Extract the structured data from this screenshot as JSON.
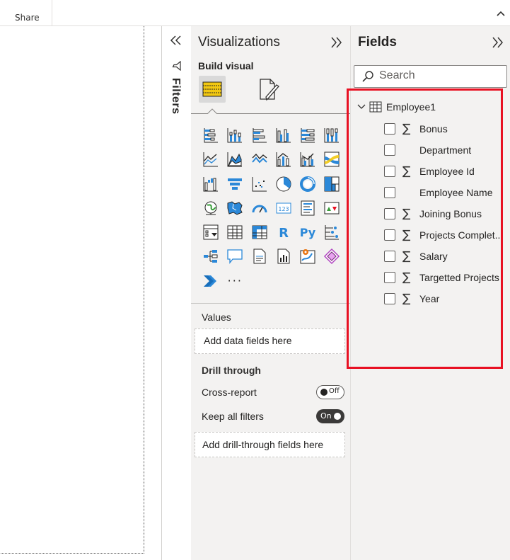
{
  "ribbon": {
    "share_label": "Share"
  },
  "filters": {
    "label": "Filters"
  },
  "visualizations": {
    "title": "Visualizations",
    "build_visual_label": "Build visual",
    "more_label": "···",
    "values_label": "Values",
    "values_placeholder": "Add data fields here",
    "drill_through_label": "Drill through",
    "cross_report_label": "Cross-report",
    "cross_report_state": "Off",
    "keep_all_filters_label": "Keep all filters",
    "keep_all_filters_state": "On",
    "drill_placeholder": "Add drill-through fields here"
  },
  "fields": {
    "title": "Fields",
    "search_placeholder": "Search",
    "table_name": "Employee1",
    "items": [
      {
        "name": "Bonus",
        "numeric": true,
        "sigma": "∑"
      },
      {
        "name": "Department",
        "numeric": false,
        "sigma": ""
      },
      {
        "name": "Employee Id",
        "numeric": true,
        "sigma": "∑"
      },
      {
        "name": "Employee Name",
        "numeric": false,
        "sigma": ""
      },
      {
        "name": "Joining Bonus",
        "numeric": true,
        "sigma": "∑"
      },
      {
        "name": "Projects Complet...",
        "numeric": true,
        "sigma": "∑"
      },
      {
        "name": "Salary",
        "numeric": true,
        "sigma": "∑"
      },
      {
        "name": "Targetted Projects",
        "numeric": true,
        "sigma": "∑"
      },
      {
        "name": "Year",
        "numeric": true,
        "sigma": "∑"
      }
    ]
  },
  "colors": {
    "highlight": "#e81123",
    "accent_blue": "#2b88d8",
    "accent_yellow": "#f2c811"
  }
}
